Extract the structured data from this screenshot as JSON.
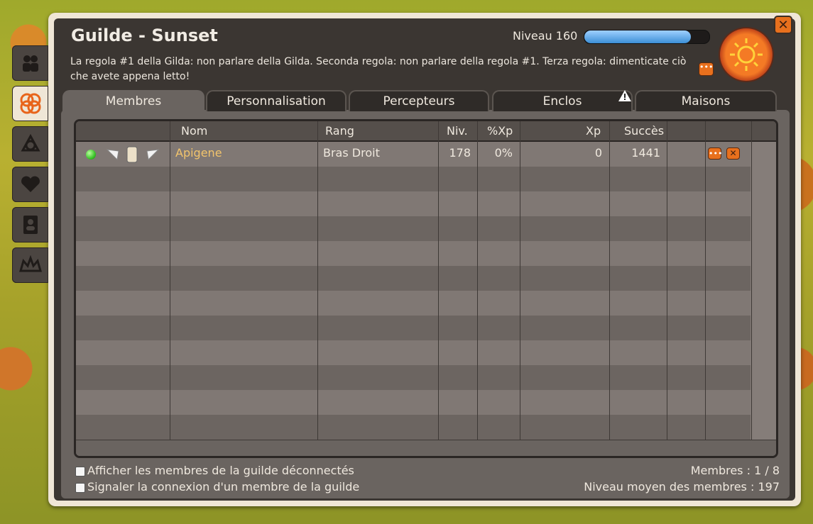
{
  "window": {
    "title": "Guilde - Sunset",
    "close_icon": "close-icon"
  },
  "guild": {
    "level_label": "Niveau 160",
    "xp_progress": 0.85
  },
  "motd": "La regola #1 della Gilda: non parlare della Gilda. Seconda regola: non parlare della regola #1. Terza regola: dimenticate ciò che avete appena letto!",
  "sidebar": {
    "items": [
      {
        "icon": "members-icon"
      },
      {
        "icon": "guild-emblem-icon",
        "active": true
      },
      {
        "icon": "alliance-icon"
      },
      {
        "icon": "heart-icon"
      },
      {
        "icon": "directory-icon"
      },
      {
        "icon": "crown-icon"
      }
    ]
  },
  "tabs": [
    {
      "label": "Membres",
      "active": true
    },
    {
      "label": "Personnalisation"
    },
    {
      "label": "Percepteurs"
    },
    {
      "label": "Enclos"
    },
    {
      "label": "Maisons"
    }
  ],
  "table": {
    "headers": {
      "nom": "Nom",
      "rang": "Rang",
      "niv": "Niv.",
      "xp_pct": "%Xp",
      "xp": "Xp",
      "succes": "Succès"
    },
    "rows": [
      {
        "nom": "Apigene",
        "rang": "Bras Droit",
        "niv": "178",
        "xp_pct": "0%",
        "xp": "0",
        "succes": "1441",
        "online": true
      }
    ]
  },
  "footer": {
    "show_offline_label": "Afficher les membres de la guilde déconnectés",
    "notify_login_label": "Signaler la connexion d'un membre de la guilde",
    "members_count": "Membres : 1 / 8",
    "avg_level": "Niveau moyen des membres : 197"
  },
  "colors": {
    "accent": "#e8701d",
    "member_name": "#f2c46c",
    "online": "#4fd13a"
  }
}
